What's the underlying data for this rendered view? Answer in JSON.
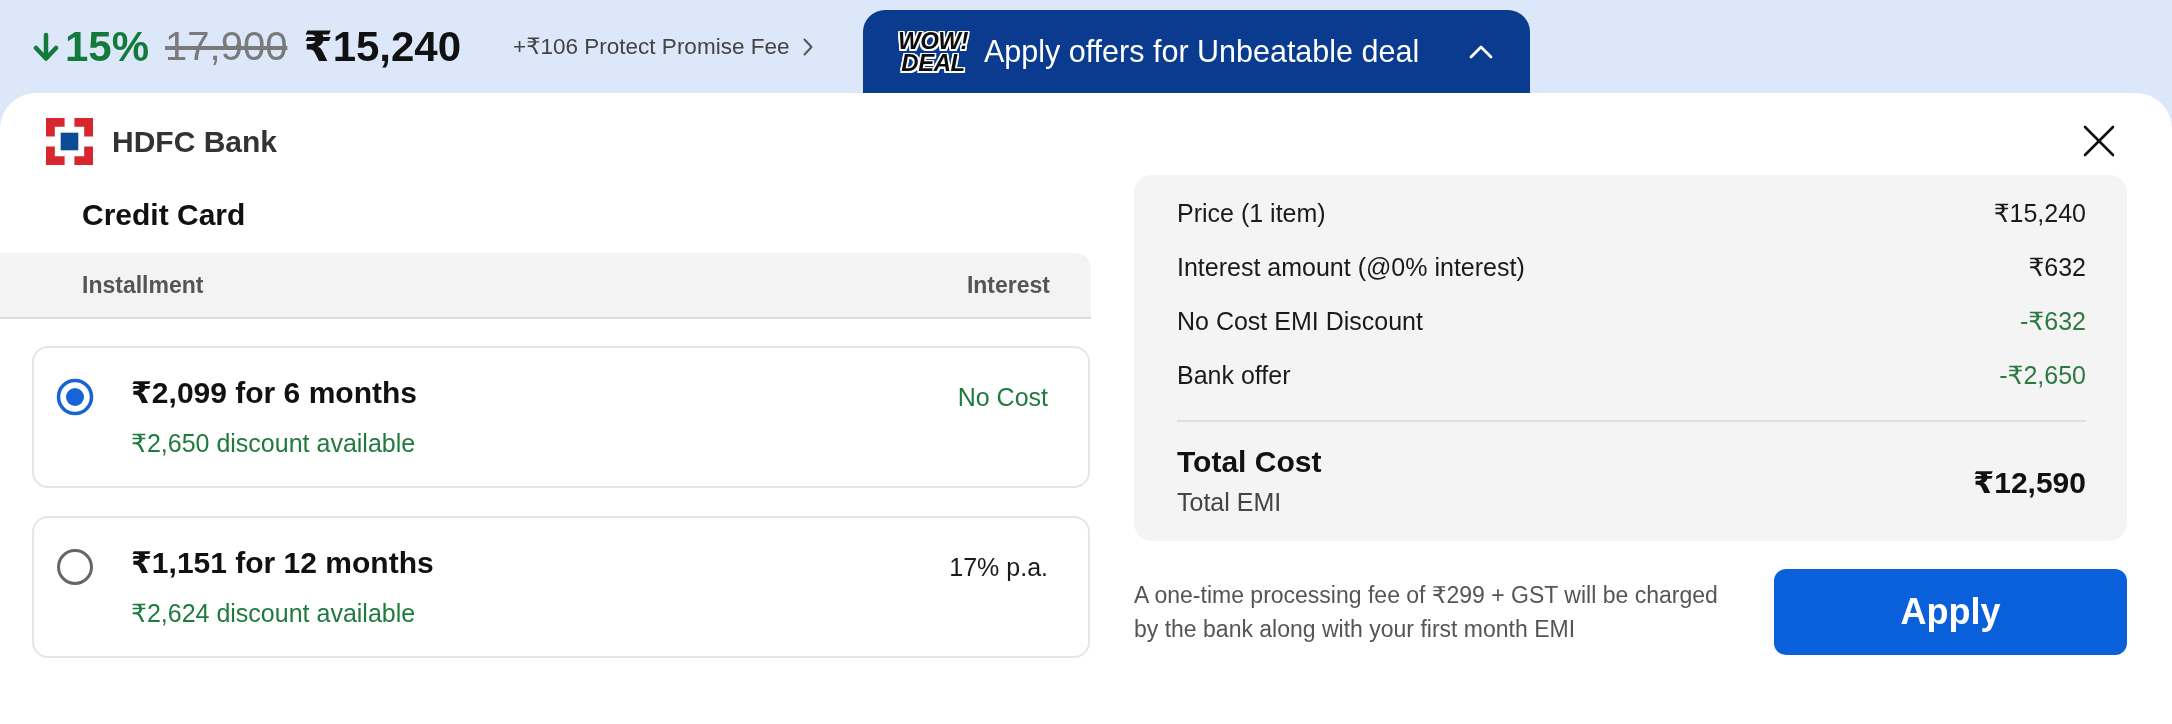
{
  "price_bar": {
    "discount": "15%",
    "original_price": "17,900",
    "price": "₹15,240",
    "protect_fee": "+₹106 Protect Promise Fee"
  },
  "offers_tab": {
    "badge": [
      "WOW!",
      "DEAL"
    ],
    "label": "Apply offers for Unbeatable deal",
    "expanded": true
  },
  "bank": {
    "name": "HDFC Bank"
  },
  "card_type": "Credit Card",
  "table": {
    "columns": [
      "Installment",
      "Interest"
    ]
  },
  "plans": [
    {
      "title": "₹2,099 for 6 months",
      "discount": "₹2,650 discount available",
      "interest": "No Cost",
      "kind": "nocost",
      "selected": true
    },
    {
      "title": "₹1,151 for 12 months",
      "discount": "₹2,624 discount available",
      "interest": "17% p.a.",
      "kind": "rate",
      "selected": false
    }
  ],
  "summary": {
    "rows": [
      {
        "label": "Price (1 item)",
        "value": "₹15,240",
        "kind": "charge"
      },
      {
        "label": "Interest amount (@0% interest)",
        "value": "₹632",
        "kind": "charge"
      },
      {
        "label": "No Cost EMI Discount",
        "value": "-₹632",
        "kind": "deduction"
      },
      {
        "label": "Bank offer",
        "value": "-₹2,650",
        "kind": "deduction"
      }
    ],
    "total": {
      "label": "Total Cost",
      "sublabel": "Total EMI",
      "value": "₹12,590"
    }
  },
  "note": "A one-time processing fee of ₹299 + GST will be charged by the bank along with your first month EMI",
  "apply_button": {
    "label": "Apply"
  }
}
